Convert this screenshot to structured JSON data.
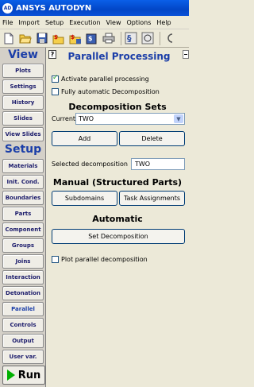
{
  "window": {
    "icon_text": "AD",
    "title": "ANSYS AUTODYN"
  },
  "menu": [
    "File",
    "Import",
    "Setup",
    "Execution",
    "View",
    "Options",
    "Help"
  ],
  "toolbar": {
    "icons": [
      "new-file-icon",
      "open-folder-icon",
      "save-icon",
      "open-special-icon",
      "save-special-icon",
      "save-as-icon",
      "print-icon",
      "settings-icon",
      "refresh-icon",
      "cycle-icon"
    ]
  },
  "sidebar": {
    "view_heading": "View",
    "view_items": [
      "Plots",
      "Settings",
      "History",
      "Slides",
      "View Slides"
    ],
    "setup_heading": "Setup",
    "setup_items": [
      "Materials",
      "Init. Cond.",
      "Boundaries",
      "Parts",
      "Component",
      "Groups",
      "Joins",
      "Interaction",
      "Detonation",
      "Parallel",
      "Controls",
      "Output",
      "User var."
    ],
    "active_item": "Parallel",
    "run_label": "Run"
  },
  "panel": {
    "help_label": "?",
    "title": "Parallel Processing",
    "activate_parallel": {
      "label": "Activate parallel processing",
      "checked": true
    },
    "fully_automatic": {
      "label": "Fully automatic Decomposition",
      "checked": false
    },
    "decomposition_sets_heading": "Decomposition Sets",
    "current_label": "Current",
    "current_value": "TWO",
    "add_label": "Add",
    "delete_label": "Delete",
    "selected_decomposition_label": "Selected decomposition",
    "selected_decomposition_value": "TWO",
    "manual_heading": "Manual (Structured Parts)",
    "subdomains_label": "Subdomains",
    "task_assignments_label": "Task Assignments",
    "automatic_heading": "Automatic",
    "set_decomposition_label": "Set Decomposition",
    "plot_parallel": {
      "label": "Plot parallel decomposition",
      "checked": false
    }
  }
}
